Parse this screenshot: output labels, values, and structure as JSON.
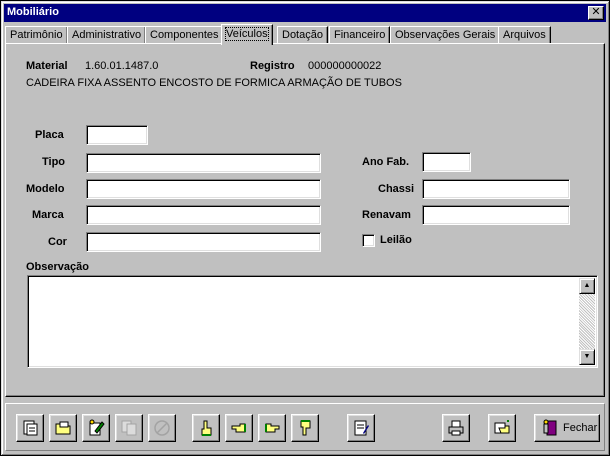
{
  "window": {
    "title": "Mobiliário",
    "close_glyph": "✕"
  },
  "tabs": [
    {
      "label": "Patrimônio"
    },
    {
      "label": "Administrativo"
    },
    {
      "label": "Componentes"
    },
    {
      "label": "Veículos"
    },
    {
      "label": "Dotação"
    },
    {
      "label": "Financeiro"
    },
    {
      "label": "Observações Gerais"
    },
    {
      "label": "Arquivos"
    }
  ],
  "active_tab": "Veículos",
  "header": {
    "material_label": "Material",
    "material_value": "1.60.01.1487.0",
    "registro_label": "Registro",
    "registro_value": "000000000022",
    "description": "CADEIRA FIXA ASSENTO ENCOSTO DE FORMICA ARMAÇÃO DE TUBOS"
  },
  "form": {
    "placa": {
      "label": "Placa",
      "value": ""
    },
    "tipo": {
      "label": "Tipo",
      "value": ""
    },
    "modelo": {
      "label": "Modelo",
      "value": ""
    },
    "marca": {
      "label": "Marca",
      "value": ""
    },
    "cor": {
      "label": "Cor",
      "value": ""
    },
    "ano_fab": {
      "label": "Ano Fab.",
      "value": ""
    },
    "chassi": {
      "label": "Chassi",
      "value": ""
    },
    "renavam": {
      "label": "Renavam",
      "value": ""
    },
    "leilao": {
      "label": "Leilão",
      "checked": false
    },
    "observacao": {
      "label": "Observação",
      "value": ""
    }
  },
  "scroll_glyphs": {
    "up": "▲",
    "down": "▼"
  },
  "toolbar": {
    "buttons": [
      {
        "icon": "new-record-icon",
        "enabled": true
      },
      {
        "icon": "open-folder-icon",
        "enabled": true
      },
      {
        "icon": "edit-record-icon",
        "enabled": true
      },
      {
        "icon": "copy-record-icon",
        "enabled": false
      },
      {
        "icon": "cancel-icon",
        "enabled": false
      },
      {
        "icon": "hand-first-icon",
        "enabled": true
      },
      {
        "icon": "hand-previous-icon",
        "enabled": true
      },
      {
        "icon": "hand-next-icon",
        "enabled": true
      },
      {
        "icon": "hand-last-icon",
        "enabled": true
      },
      {
        "icon": "notes-icon",
        "enabled": true
      },
      {
        "icon": "printer-icon",
        "enabled": true
      },
      {
        "icon": "search-hand-icon",
        "enabled": true
      }
    ],
    "close_label": "Fechar",
    "close_icon": "exit-door-icon"
  },
  "colors": {
    "titlebar": "#000080",
    "face": "#c0c0c0",
    "field": "#ffffff"
  }
}
